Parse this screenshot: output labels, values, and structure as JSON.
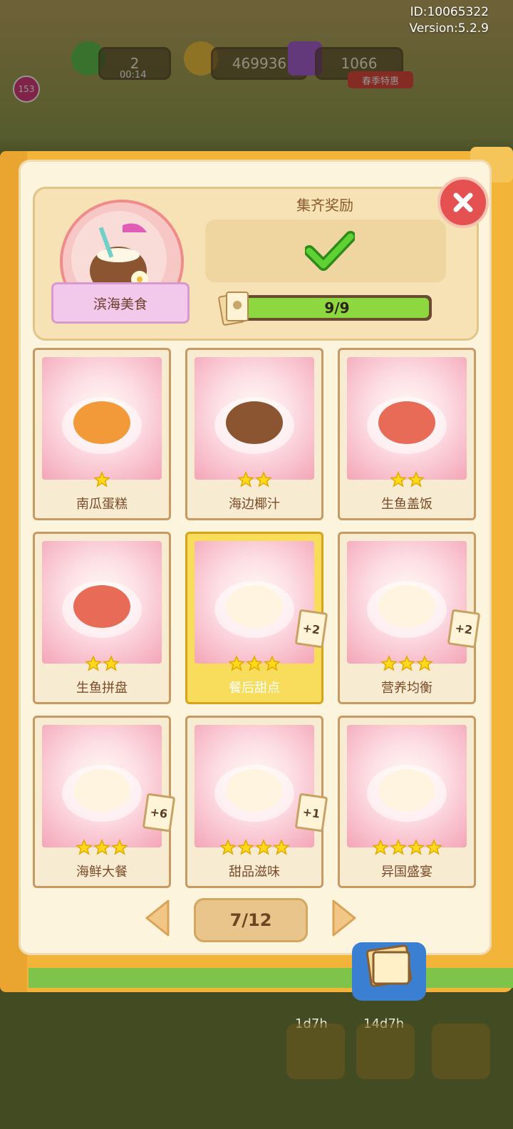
{
  "account": {
    "id_text": "ID:10065322",
    "version_text": "Version:5.2.9"
  },
  "hud": {
    "energy": "2",
    "energy_timer": "00:14",
    "coins": "469936",
    "gems": "1066",
    "promo_label": "春季特惠",
    "level_badge": "153"
  },
  "collection": {
    "name": "滨海美食",
    "reward_title": "集齐奖励",
    "progress_text": "9/9",
    "progress_fraction": 1.0,
    "accent_color": "#8ed83f"
  },
  "cards": [
    {
      "name": "南瓜蛋糕",
      "stars": 1,
      "bonus": "",
      "highlight": false,
      "art": "pumpkin-cake-icon"
    },
    {
      "name": "海边椰汁",
      "stars": 2,
      "bonus": "",
      "highlight": false,
      "art": "coconut-drink-icon"
    },
    {
      "name": "生鱼盖饭",
      "stars": 2,
      "bonus": "",
      "highlight": false,
      "art": "salmon-bento-icon"
    },
    {
      "name": "生鱼拼盘",
      "stars": 2,
      "bonus": "",
      "highlight": false,
      "art": "sashimi-platter-icon"
    },
    {
      "name": "餐后甜点",
      "stars": 3,
      "bonus": "+2",
      "highlight": true,
      "art": "duck-dessert-icon"
    },
    {
      "name": "营养均衡",
      "stars": 3,
      "bonus": "+2",
      "highlight": false,
      "art": "duck-balanced-meal-icon"
    },
    {
      "name": "海鲜大餐",
      "stars": 3,
      "bonus": "+6",
      "highlight": false,
      "art": "duck-seafood-feast-icon"
    },
    {
      "name": "甜品滋味",
      "stars": 4,
      "bonus": "+1",
      "highlight": false,
      "art": "duck-sweets-icon"
    },
    {
      "name": "异国盛宴",
      "stars": 4,
      "bonus": "",
      "highlight": false,
      "art": "duck-exotic-banquet-icon"
    }
  ],
  "pager": {
    "text": "7/12"
  },
  "bottom_bar": {
    "timer_1": "1d7h",
    "timer_2": "14d7h"
  }
}
